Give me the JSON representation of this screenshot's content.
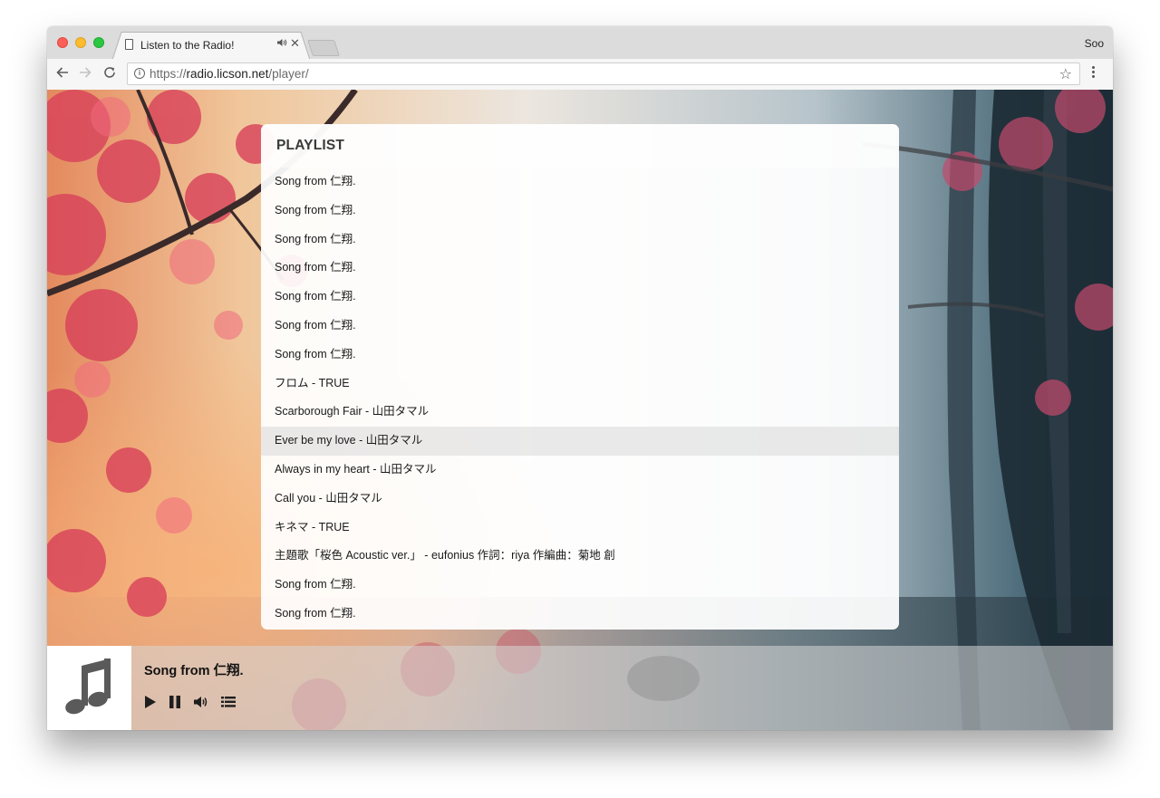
{
  "browser": {
    "tab_title": "Listen to the Radio!",
    "profile_name": "Soo",
    "url_scheme": "https://",
    "url_host": "radio.licson.net",
    "url_path": "/player/"
  },
  "icons": {
    "back": "back-arrow-icon",
    "forward": "forward-arrow-icon",
    "reload": "reload-icon",
    "info": "info-icon",
    "star": "star-icon",
    "menu": "kebab-menu-icon",
    "tab_audio": "speaker-icon",
    "tab_close": "close-icon",
    "album": "music-note-icon",
    "play": "play-icon",
    "pause": "pause-icon",
    "volume": "volume-icon",
    "playlist": "playlist-icon"
  },
  "colors": {
    "tab_strip": "#dcdcdc",
    "toolbar": "#f6f6f6",
    "active_row": "#e6e6e6"
  },
  "playlist": {
    "title": "PLAYLIST",
    "items": [
      "Song from 仁翔.",
      "Song from 仁翔.",
      "Song from 仁翔.",
      "Song from 仁翔.",
      "Song from 仁翔.",
      "Song from 仁翔.",
      "Song from 仁翔.",
      "フロム - TRUE",
      "Scarborough Fair - 山田タマル",
      "Ever be my love - 山田タマル",
      "Always in my heart - 山田タマル",
      "Call you - 山田タマル",
      "キネマ - TRUE",
      "主題歌「桜色 Acoustic ver.」 - eufonius 作詞：riya 作編曲：菊地 創",
      "Song from 仁翔.",
      "Song from 仁翔."
    ],
    "active_index": 9
  },
  "player": {
    "now_playing": "Song from 仁翔."
  }
}
